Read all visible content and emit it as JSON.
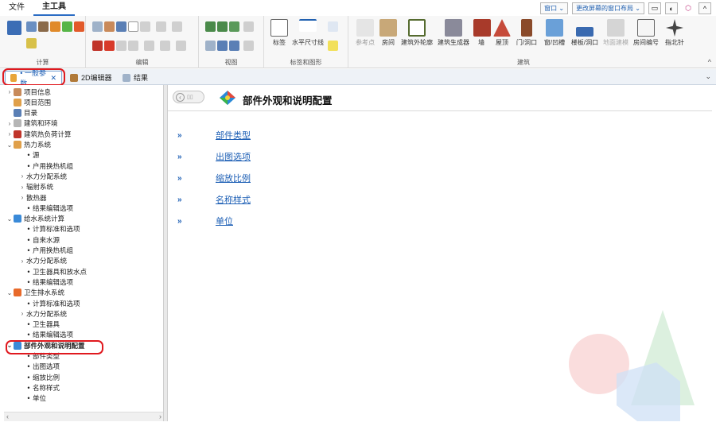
{
  "menu": {
    "file": "文件",
    "main_tools": "主工具",
    "window_dd": "窗口",
    "layout_dd": "更改屏幕的窗口布局"
  },
  "ribbon": {
    "groups": {
      "calc": "计算",
      "edit": "编辑",
      "view": "视图",
      "annot": "标签和图形",
      "building": "建筑"
    },
    "buttons": {
      "label": "标签",
      "hdim": "水平尺寸线",
      "refpoint": "参考点",
      "room": "房间",
      "outline": "建筑外轮廓",
      "generator": "建筑生成器",
      "wall": "墙",
      "roof": "屋顶",
      "door": "门/洞口",
      "window": "窗/凹槽",
      "floor": "楼板/洞口",
      "georef": "地面建模",
      "roomnum": "房间编号",
      "compass": "指北针"
    }
  },
  "tabs": [
    {
      "label": "• 一般参数",
      "close": "✕"
    },
    {
      "label": "2D编辑器"
    },
    {
      "label": "结果"
    }
  ],
  "tree": [
    {
      "label": "项目信息",
      "arrow": "›",
      "type": "node"
    },
    {
      "label": "项目范围",
      "arrow": "",
      "type": "node"
    },
    {
      "label": "目录",
      "arrow": "",
      "type": "node"
    },
    {
      "label": "建筑和环境",
      "arrow": "›",
      "type": "node"
    },
    {
      "label": "建筑热负荷计算",
      "arrow": "›",
      "type": "node"
    },
    {
      "label": "热力系统",
      "arrow": "⌄",
      "type": "node"
    },
    {
      "label": "源",
      "arrow": "",
      "type": "leaf"
    },
    {
      "label": "户用换热机组",
      "arrow": "",
      "type": "leaf"
    },
    {
      "label": "水力分配系统",
      "arrow": "›",
      "type": "sub"
    },
    {
      "label": "辐射系统",
      "arrow": "›",
      "type": "sub"
    },
    {
      "label": "散热器",
      "arrow": "›",
      "type": "sub"
    },
    {
      "label": "结果编辑选项",
      "arrow": "",
      "type": "leaf"
    },
    {
      "label": "给水系统计算",
      "arrow": "⌄",
      "type": "node"
    },
    {
      "label": "计算标准和选项",
      "arrow": "",
      "type": "leaf"
    },
    {
      "label": "自来水源",
      "arrow": "",
      "type": "leaf"
    },
    {
      "label": "户用换热机组",
      "arrow": "",
      "type": "leaf"
    },
    {
      "label": "水力分配系统",
      "arrow": "›",
      "type": "sub"
    },
    {
      "label": "卫生器具和放水点",
      "arrow": "",
      "type": "leaf"
    },
    {
      "label": "结果编辑选项",
      "arrow": "",
      "type": "leaf"
    },
    {
      "label": "卫生排水系统",
      "arrow": "⌄",
      "type": "node"
    },
    {
      "label": "计算标准和选项",
      "arrow": "",
      "type": "leaf"
    },
    {
      "label": "水力分配系统",
      "arrow": "›",
      "type": "sub"
    },
    {
      "label": "卫生器具",
      "arrow": "",
      "type": "leaf"
    },
    {
      "label": "结果编辑选项",
      "arrow": "",
      "type": "leaf"
    },
    {
      "label": "部件外观和说明配置",
      "arrow": "⌄",
      "type": "node",
      "bold": true
    },
    {
      "label": "部件类型",
      "arrow": "",
      "type": "leaf"
    },
    {
      "label": "出图选项",
      "arrow": "",
      "type": "leaf"
    },
    {
      "label": "缩放比例",
      "arrow": "",
      "type": "leaf"
    },
    {
      "label": "名称样式",
      "arrow": "",
      "type": "leaf"
    },
    {
      "label": "单位",
      "arrow": "",
      "type": "leaf"
    }
  ],
  "content": {
    "title": "部件外观和说明配置",
    "links": [
      "部件类型",
      "出图选项",
      "缩放比例",
      "名称样式",
      "单位"
    ],
    "chevron": "»"
  },
  "colors": {
    "accent": "#1d5fb5",
    "highlight": "#e0191f"
  }
}
